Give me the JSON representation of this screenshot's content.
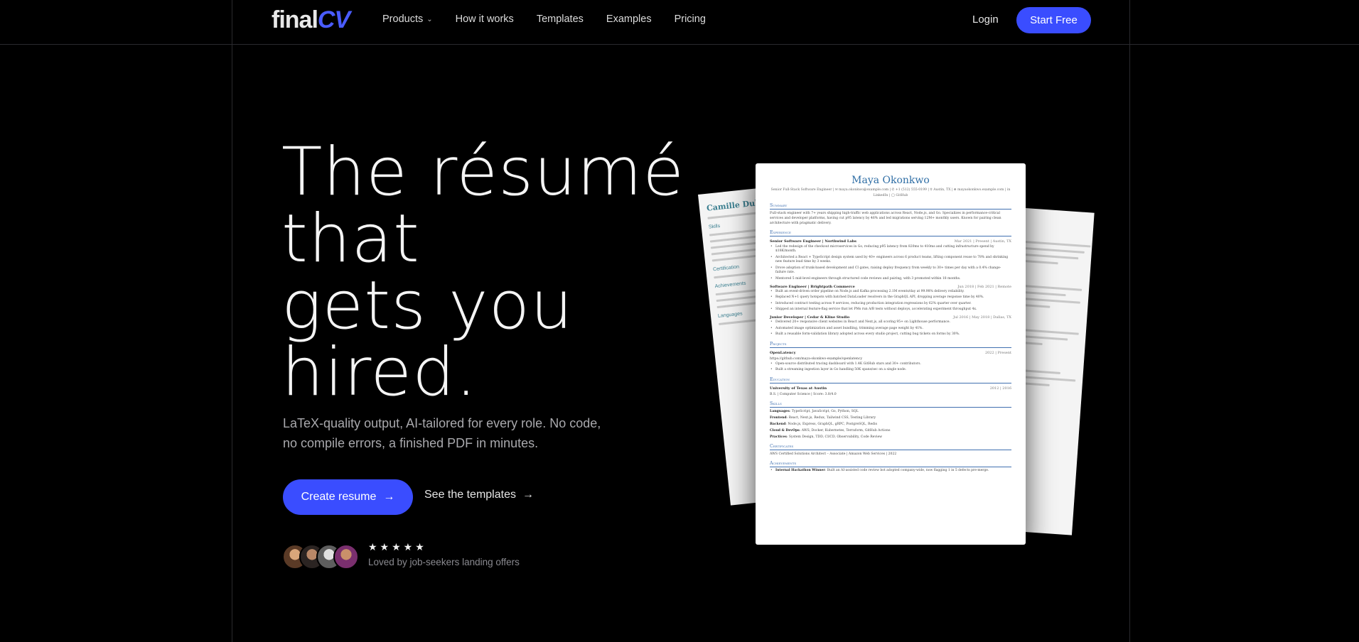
{
  "brand": {
    "part1": "final",
    "part2": "CV"
  },
  "nav": {
    "items": [
      {
        "label": "Products",
        "has_dropdown": true
      },
      {
        "label": "How it works"
      },
      {
        "label": "Templates"
      },
      {
        "label": "Examples"
      },
      {
        "label": "Pricing"
      }
    ],
    "login": "Login",
    "start": "Start Free"
  },
  "hero": {
    "title_lines": [
      "The résumé",
      "that",
      "gets you",
      "hired."
    ],
    "subtitle": "LaTeX-quality output, AI-tailored for every role. No code, no compile errors, a finished PDF in minutes.",
    "cta_primary": "Create resume",
    "cta_secondary": "See the templates",
    "stars": "★★★★★",
    "social_proof": "Loved by job-seekers landing offers"
  },
  "colors": {
    "accent": "#3a4dff",
    "background": "#000000"
  },
  "icons": {
    "arrow": "arrow-right-icon",
    "dropdown": "chevron-down-icon",
    "star": "star-icon"
  },
  "resume_back_left": {
    "name": "Camille Dubois",
    "sections": [
      "Skills",
      "Certification",
      "Achievements",
      "Languages"
    ]
  },
  "resume": {
    "name": "Maya Okonkwo",
    "contact": "Senior Full-Stack Software Engineer | ✉ maya.okonkwo@example.com | ✆ +1 (512) 555-0199 | ⚲ Austin, TX | ⊕ mayaokonkwo.example.com | in LinkedIn | ◯ GitHub",
    "summary_head": "Summary",
    "summary": "Full-stack engineer with 7+ years shipping high-traffic web applications across React, Node.js, and Go. Specializes in performance-critical services and developer platforms, having cut p95 latency by 46% and led migrations serving 12M+ monthly users. Known for pairing clean architecture with pragmatic delivery.",
    "experience_head": "Experience",
    "jobs": [
      {
        "title": "Senior Software Engineer | Northwind Labs",
        "date": "Mar 2021 | Present | Austin, TX",
        "bullets": [
          "Led the redesign of the checkout microservices in Go, reducing p95 latency from 820ms to 410ms and cutting infrastructure spend by $18K/month.",
          "Architected a React + TypeScript design system used by 40+ engineers across 6 product teams, lifting component reuse to 78% and shrinking new feature lead time by 3 weeks.",
          "Drove adoption of trunk-based development and CI gates, raising deploy frequency from weekly to 30+ times per day with a 0.4% change-failure rate.",
          "Mentored 5 mid-level engineers through structured code reviews and pairing, with 3 promoted within 18 months."
        ]
      },
      {
        "title": "Software Engineer | Brightpath Commerce",
        "date": "Jun 2018 | Feb 2021 | Remote",
        "bullets": [
          "Built an event-driven order pipeline on Node.js and Kafka processing 2.1M events/day at 99.98% delivery reliability.",
          "Replaced N+1 query hotspots with batched DataLoader resolvers in the GraphQL API, dropping average response time by 40%.",
          "Introduced contract testing across 9 services, reducing production integration regressions by 62% quarter over quarter.",
          "Shipped an internal feature-flag service that let PMs run A/B tests without deploys, accelerating experiment throughput 4x."
        ]
      },
      {
        "title": "Junior Developer | Cedar & Kline Studio",
        "date": "Jul 2016 | May 2018 | Dallas, TX",
        "bullets": [
          "Delivered 20+ responsive client websites in React and Next.js, all scoring 95+ on Lighthouse performance.",
          "Automated image optimization and asset bundling, trimming average page weight by 41%.",
          "Built a reusable form-validation library adopted across every studio project, cutting bug tickets on forms by 30%."
        ]
      }
    ],
    "projects_head": "Projects",
    "project_title": "OpenLatency",
    "project_date": "2022 | Present",
    "project_url": "https://github.com/maya-okonkwo-example/openlatency",
    "project_bullets": [
      "Open-source distributed tracing dashboard with 1.4K GitHub stars and 30+ contributors.",
      "Built a streaming ingestion layer in Go handling 50K spans/sec on a single node."
    ],
    "education_head": "Education",
    "school": "University of Texas at Austin",
    "school_date": "2012 | 2016",
    "degree": "B.S. | Computer Science | Score: 3.8/4.0",
    "skills_head": "Skills",
    "skills": [
      {
        "k": "Languages",
        "v": "TypeScript, JavaScript, Go, Python, SQL"
      },
      {
        "k": "Frontend",
        "v": "React, Next.js, Redux, Tailwind CSS, Testing Library"
      },
      {
        "k": "Backend",
        "v": "Node.js, Express, GraphQL, gRPC, PostgreSQL, Redis"
      },
      {
        "k": "Cloud & DevOps",
        "v": "AWS, Docker, Kubernetes, Terraform, GitHub Actions"
      },
      {
        "k": "Practices",
        "v": "System Design, TDD, CI/CD, Observability, Code Review"
      }
    ],
    "cert_head": "Certificates",
    "cert": "AWS Certified Solutions Architect – Associate | Amazon Web Services | 2022",
    "achievements_head": "Achievements",
    "achievement_k": "Internal Hackathon Winner",
    "achievement_v": ": Built an AI-assisted code review bot adopted company-wide, now flagging 1 in 5 defects pre-merge."
  }
}
